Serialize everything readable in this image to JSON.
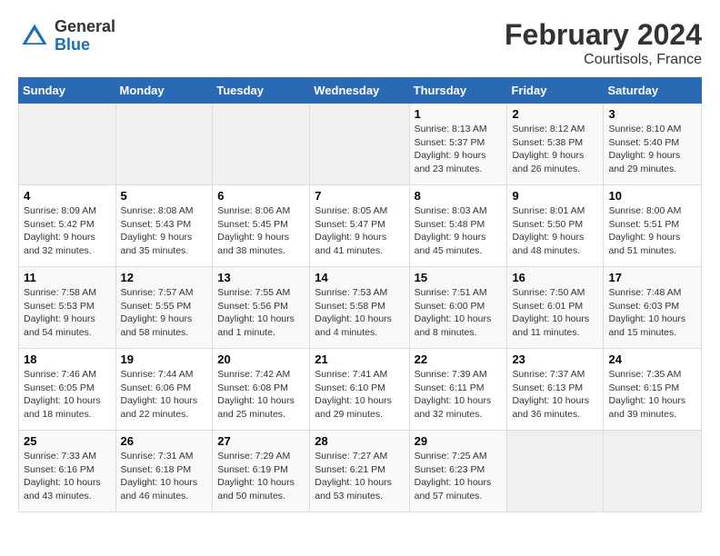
{
  "header": {
    "logo_general": "General",
    "logo_blue": "Blue",
    "month_year": "February 2024",
    "location": "Courtisols, France"
  },
  "days_of_week": [
    "Sunday",
    "Monday",
    "Tuesday",
    "Wednesday",
    "Thursday",
    "Friday",
    "Saturday"
  ],
  "weeks": [
    [
      {
        "day": "",
        "empty": true
      },
      {
        "day": "",
        "empty": true
      },
      {
        "day": "",
        "empty": true
      },
      {
        "day": "",
        "empty": true
      },
      {
        "day": "1",
        "sunrise": "8:13 AM",
        "sunset": "5:37 PM",
        "daylight": "9 hours and 23 minutes."
      },
      {
        "day": "2",
        "sunrise": "8:12 AM",
        "sunset": "5:38 PM",
        "daylight": "9 hours and 26 minutes."
      },
      {
        "day": "3",
        "sunrise": "8:10 AM",
        "sunset": "5:40 PM",
        "daylight": "9 hours and 29 minutes."
      }
    ],
    [
      {
        "day": "4",
        "sunrise": "8:09 AM",
        "sunset": "5:42 PM",
        "daylight": "9 hours and 32 minutes."
      },
      {
        "day": "5",
        "sunrise": "8:08 AM",
        "sunset": "5:43 PM",
        "daylight": "9 hours and 35 minutes."
      },
      {
        "day": "6",
        "sunrise": "8:06 AM",
        "sunset": "5:45 PM",
        "daylight": "9 hours and 38 minutes."
      },
      {
        "day": "7",
        "sunrise": "8:05 AM",
        "sunset": "5:47 PM",
        "daylight": "9 hours and 41 minutes."
      },
      {
        "day": "8",
        "sunrise": "8:03 AM",
        "sunset": "5:48 PM",
        "daylight": "9 hours and 45 minutes."
      },
      {
        "day": "9",
        "sunrise": "8:01 AM",
        "sunset": "5:50 PM",
        "daylight": "9 hours and 48 minutes."
      },
      {
        "day": "10",
        "sunrise": "8:00 AM",
        "sunset": "5:51 PM",
        "daylight": "9 hours and 51 minutes."
      }
    ],
    [
      {
        "day": "11",
        "sunrise": "7:58 AM",
        "sunset": "5:53 PM",
        "daylight": "9 hours and 54 minutes."
      },
      {
        "day": "12",
        "sunrise": "7:57 AM",
        "sunset": "5:55 PM",
        "daylight": "9 hours and 58 minutes."
      },
      {
        "day": "13",
        "sunrise": "7:55 AM",
        "sunset": "5:56 PM",
        "daylight": "10 hours and 1 minute."
      },
      {
        "day": "14",
        "sunrise": "7:53 AM",
        "sunset": "5:58 PM",
        "daylight": "10 hours and 4 minutes."
      },
      {
        "day": "15",
        "sunrise": "7:51 AM",
        "sunset": "6:00 PM",
        "daylight": "10 hours and 8 minutes."
      },
      {
        "day": "16",
        "sunrise": "7:50 AM",
        "sunset": "6:01 PM",
        "daylight": "10 hours and 11 minutes."
      },
      {
        "day": "17",
        "sunrise": "7:48 AM",
        "sunset": "6:03 PM",
        "daylight": "10 hours and 15 minutes."
      }
    ],
    [
      {
        "day": "18",
        "sunrise": "7:46 AM",
        "sunset": "6:05 PM",
        "daylight": "10 hours and 18 minutes."
      },
      {
        "day": "19",
        "sunrise": "7:44 AM",
        "sunset": "6:06 PM",
        "daylight": "10 hours and 22 minutes."
      },
      {
        "day": "20",
        "sunrise": "7:42 AM",
        "sunset": "6:08 PM",
        "daylight": "10 hours and 25 minutes."
      },
      {
        "day": "21",
        "sunrise": "7:41 AM",
        "sunset": "6:10 PM",
        "daylight": "10 hours and 29 minutes."
      },
      {
        "day": "22",
        "sunrise": "7:39 AM",
        "sunset": "6:11 PM",
        "daylight": "10 hours and 32 minutes."
      },
      {
        "day": "23",
        "sunrise": "7:37 AM",
        "sunset": "6:13 PM",
        "daylight": "10 hours and 36 minutes."
      },
      {
        "day": "24",
        "sunrise": "7:35 AM",
        "sunset": "6:15 PM",
        "daylight": "10 hours and 39 minutes."
      }
    ],
    [
      {
        "day": "25",
        "sunrise": "7:33 AM",
        "sunset": "6:16 PM",
        "daylight": "10 hours and 43 minutes."
      },
      {
        "day": "26",
        "sunrise": "7:31 AM",
        "sunset": "6:18 PM",
        "daylight": "10 hours and 46 minutes."
      },
      {
        "day": "27",
        "sunrise": "7:29 AM",
        "sunset": "6:19 PM",
        "daylight": "10 hours and 50 minutes."
      },
      {
        "day": "28",
        "sunrise": "7:27 AM",
        "sunset": "6:21 PM",
        "daylight": "10 hours and 53 minutes."
      },
      {
        "day": "29",
        "sunrise": "7:25 AM",
        "sunset": "6:23 PM",
        "daylight": "10 hours and 57 minutes."
      },
      {
        "day": "",
        "empty": true
      },
      {
        "day": "",
        "empty": true
      }
    ]
  ]
}
